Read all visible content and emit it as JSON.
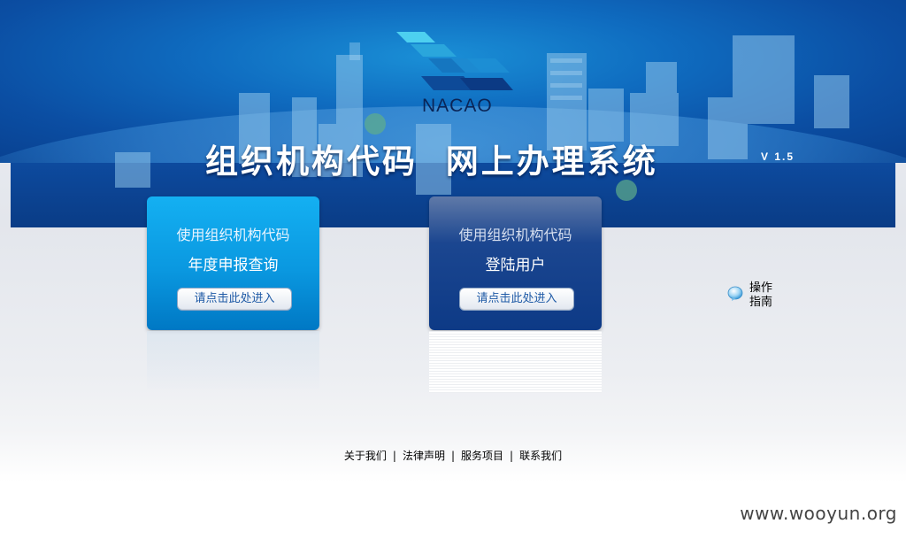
{
  "header": {
    "logo_text": "NACAO",
    "title": "组织机构代码  网上办理系统",
    "version": "V 1.5"
  },
  "cards": [
    {
      "line1": "使用组织机构代码",
      "line2": "年度申报查询",
      "button_label": "请点击此处进入"
    },
    {
      "line1": "使用组织机构代码",
      "line2": "登陆用户",
      "button_label": "请点击此处进入"
    }
  ],
  "guide": {
    "label": "操作指南",
    "icon": "speech-bubble-icon"
  },
  "footer": {
    "links": [
      "关于我们",
      "法律声明",
      "服务项目",
      "联系我们"
    ],
    "separator": "|"
  },
  "watermark": "www.wooyun.org",
  "colors": {
    "banner_blue": "#0b4ea3",
    "card1_blue": "#0a98e0",
    "card2_navy": "#0d3a86"
  }
}
